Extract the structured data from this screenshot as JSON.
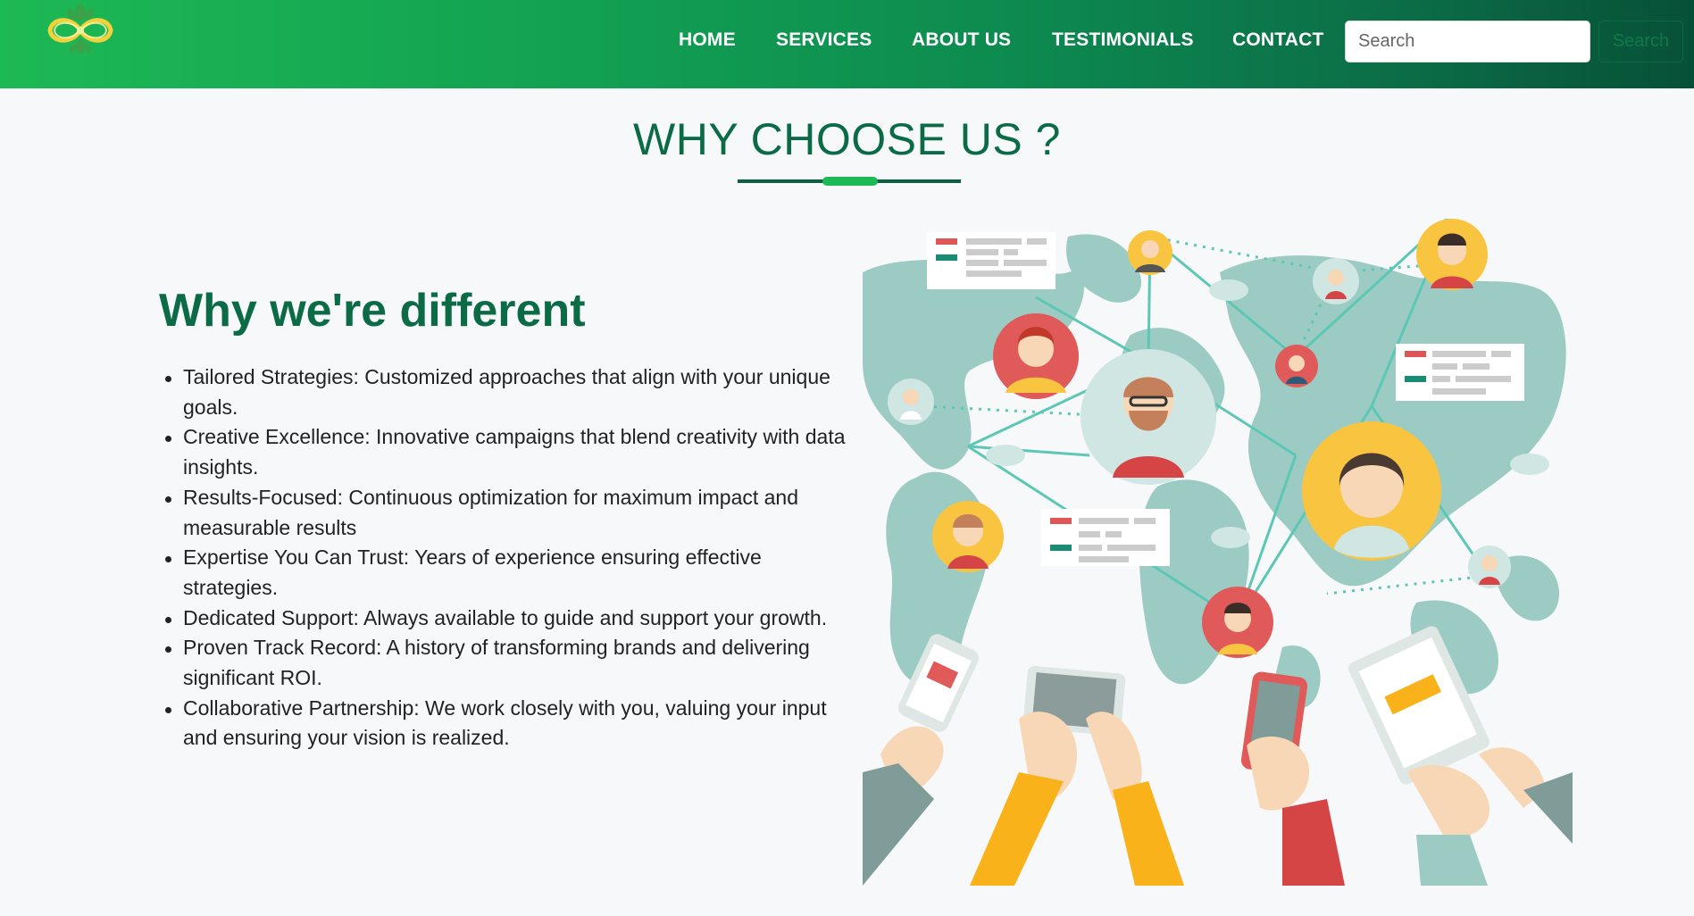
{
  "nav": {
    "links": [
      "HOME",
      "SERVICES",
      "ABOUT US",
      "TESTIMONIALS",
      "CONTACT"
    ],
    "search_placeholder": "Search",
    "search_button": "Search"
  },
  "section": {
    "title": "WHY CHOOSE US ?",
    "subheading": "Why we're different",
    "features": [
      "Tailored Strategies: Customized approaches that align with your unique goals.",
      "Creative Excellence: Innovative campaigns that blend creativity with data insights.",
      "Results-Focused: Continuous optimization for maximum impact and measurable results",
      "Expertise You Can Trust: Years of experience ensuring effective strategies.",
      "Dedicated Support: Always available to guide and support your growth.",
      "Proven Track Record: A history of transforming brands and delivering significant ROI.",
      "Collaborative Partnership: We work closely with you, valuing your input and ensuring your vision is realized."
    ]
  },
  "colors": {
    "brand_green": "#0c6b47",
    "accent_green": "#1db954",
    "map_teal": "#9ccbc4"
  }
}
